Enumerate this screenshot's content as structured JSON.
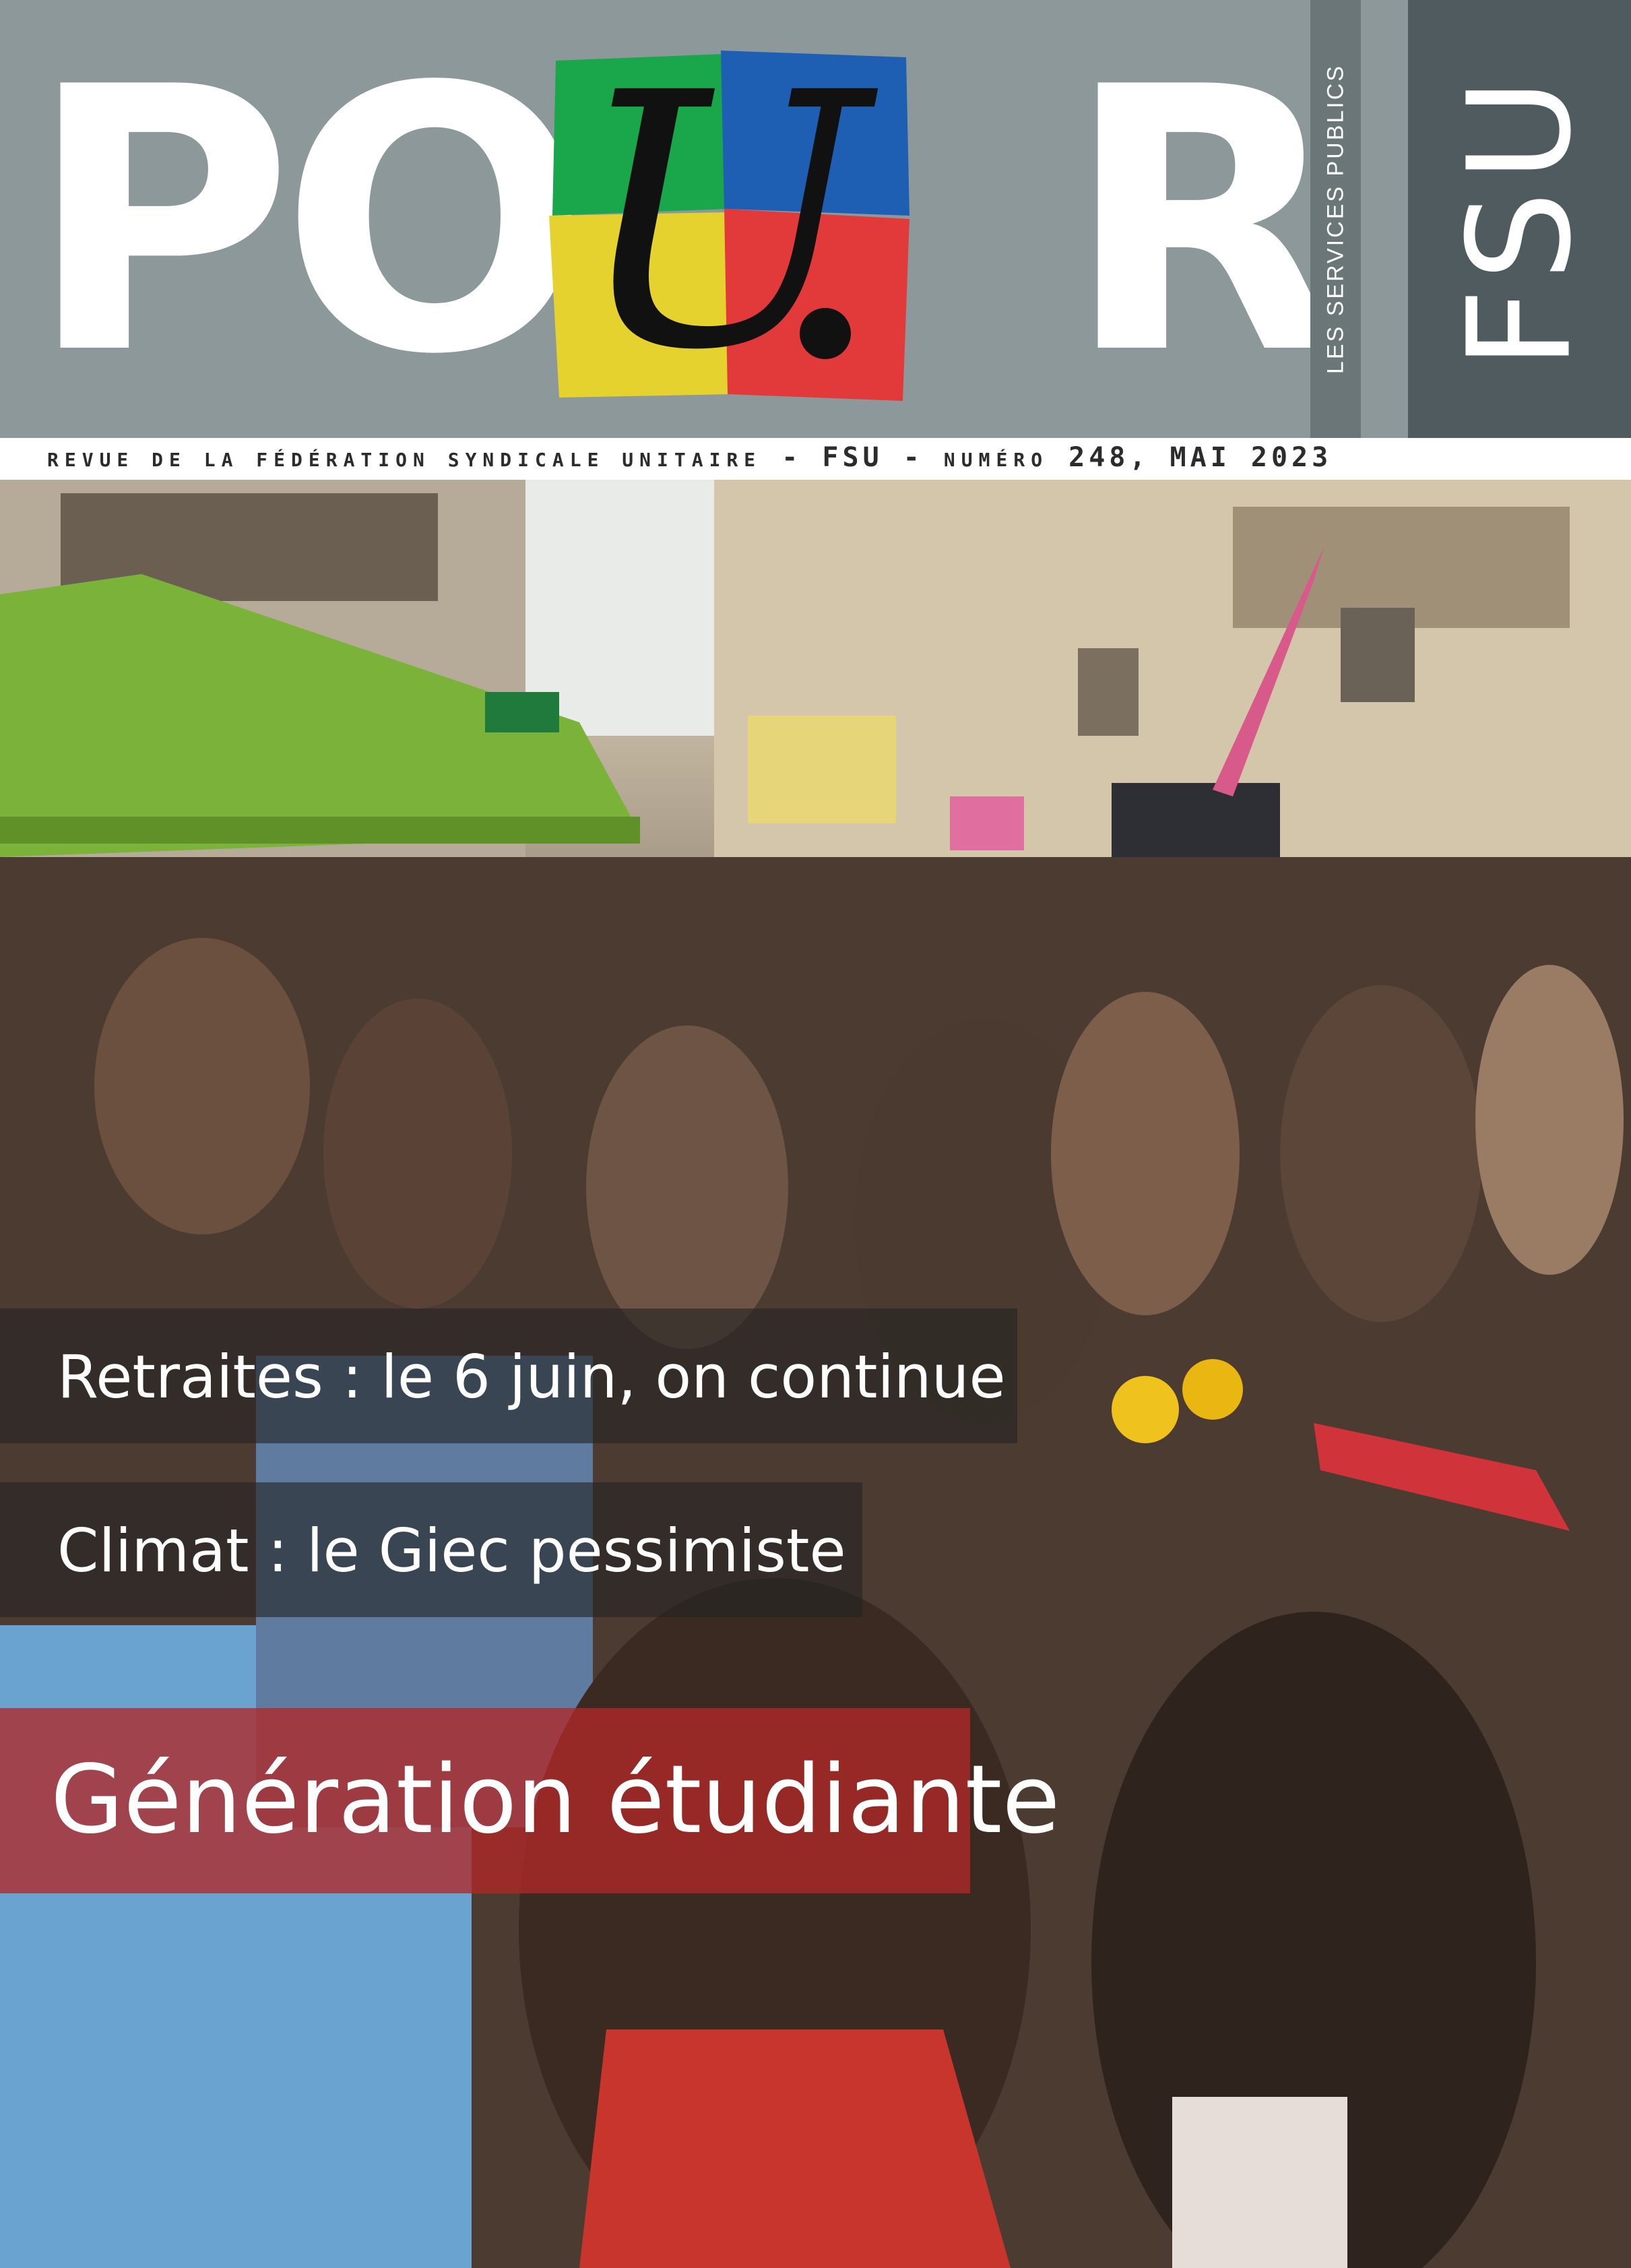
{
  "masthead": {
    "title_left": "PO",
    "title_right": "R",
    "logo_letter": "U",
    "side_label": "LES SERVICES PUBLICS",
    "brand": "FSU",
    "colors": {
      "background": "#8d989a",
      "band_dark": "#4f5b5e",
      "logo_green": "#1aa64a",
      "logo_blue": "#1e5fb4",
      "logo_yellow": "#e5d22e",
      "logo_red": "#e23a3a"
    }
  },
  "subtitle": {
    "part1": "REVUE DE LA FÉDÉRATION SYNDICALE UNITAIRE",
    "sep1": " - FSU - ",
    "part2": "NUMÉRO",
    "part3": " 248, MAI 2023"
  },
  "headlines": {
    "first": "Retraites : le 6 juin, on continue",
    "second": "Climat : le Giec pessimiste",
    "main": "Génération étudiante"
  }
}
